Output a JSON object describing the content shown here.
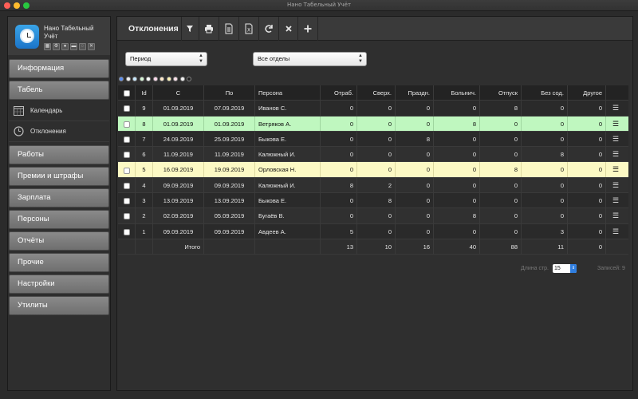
{
  "window": {
    "title": "Нано Табельный Учёт"
  },
  "app": {
    "name": "Нано Табельный Учёт",
    "mini_icons": [
      "calendar-mini-icon",
      "gear-mini-icon",
      "person-mini-icon",
      "card-mini-icon",
      "chat-mini-icon",
      "tools-mini-icon"
    ]
  },
  "sidebar": {
    "buttons": [
      {
        "label": "Информация"
      },
      {
        "label": "Табель"
      },
      {
        "label": "Работы"
      },
      {
        "label": "Премии и штрафы"
      },
      {
        "label": "Зарплата"
      },
      {
        "label": "Персоны"
      },
      {
        "label": "Отчёты"
      },
      {
        "label": "Прочие"
      },
      {
        "label": "Настройки"
      },
      {
        "label": "Утилиты"
      }
    ],
    "sub_items": [
      {
        "label": "Календарь",
        "icon": "calendar-icon"
      },
      {
        "label": "Отклонения",
        "icon": "clock-icon"
      }
    ]
  },
  "toolbar": {
    "title": "Отклонения",
    "buttons": [
      "filter-icon",
      "print-icon",
      "document-icon",
      "excel-icon",
      "refresh-icon",
      "close-icon",
      "add-icon"
    ]
  },
  "filters": {
    "period": "Период",
    "department": "Все отделы"
  },
  "colors": {
    "dots": [
      "#5b8ef2",
      "#f2f2f2",
      "#c7e8ff",
      "#d7f7d7",
      "#ffffff",
      "#ffd9ec",
      "#ffe9c9",
      "#fff4b3",
      "#fce0ea",
      "#f3f3f3",
      "#222222"
    ],
    "highlight_green": "#bff7bf",
    "highlight_yellow": "#fcf9c4"
  },
  "table": {
    "headers": [
      "Id",
      "С",
      "По",
      "Персона",
      "Отраб.",
      "Сверх.",
      "Праздн.",
      "Больнич.",
      "Отпуск",
      "Без сод.",
      "Другое"
    ],
    "rows": [
      {
        "id": "9",
        "from": "01.09.2019",
        "to": "07.09.2019",
        "person": "Иванов С.",
        "v": [
          "0",
          "0",
          "0",
          "0",
          "8",
          "0",
          "0"
        ],
        "hl": ""
      },
      {
        "id": "8",
        "from": "01.09.2019",
        "to": "01.09.2019",
        "person": "Ветряков А.",
        "v": [
          "0",
          "0",
          "0",
          "8",
          "0",
          "0",
          "0"
        ],
        "hl": "green"
      },
      {
        "id": "7",
        "from": "24.09.2019",
        "to": "25.09.2019",
        "person": "Быкова Е.",
        "v": [
          "0",
          "0",
          "8",
          "0",
          "0",
          "0",
          "0"
        ],
        "hl": ""
      },
      {
        "id": "6",
        "from": "11.09.2019",
        "to": "11.09.2019",
        "person": "Калюжный И.",
        "v": [
          "0",
          "0",
          "0",
          "0",
          "0",
          "8",
          "0"
        ],
        "hl": ""
      },
      {
        "id": "5",
        "from": "16.09.2019",
        "to": "19.09.2019",
        "person": "Орловская Н.",
        "v": [
          "0",
          "0",
          "0",
          "0",
          "8",
          "0",
          "0"
        ],
        "hl": "yellow"
      },
      {
        "id": "4",
        "from": "09.09.2019",
        "to": "09.09.2019",
        "person": "Калюжный И.",
        "v": [
          "8",
          "2",
          "0",
          "0",
          "0",
          "0",
          "0"
        ],
        "hl": ""
      },
      {
        "id": "3",
        "from": "13.09.2019",
        "to": "13.09.2019",
        "person": "Быкова Е.",
        "v": [
          "0",
          "8",
          "0",
          "0",
          "0",
          "0",
          "0"
        ],
        "hl": ""
      },
      {
        "id": "2",
        "from": "02.09.2019",
        "to": "05.09.2019",
        "person": "Бугаёв В.",
        "v": [
          "0",
          "0",
          "0",
          "8",
          "0",
          "0",
          "0"
        ],
        "hl": ""
      },
      {
        "id": "1",
        "from": "09.09.2019",
        "to": "09.09.2019",
        "person": "Авдеев А.",
        "v": [
          "5",
          "0",
          "0",
          "0",
          "0",
          "3",
          "0"
        ],
        "hl": ""
      }
    ],
    "total_label": "Итого",
    "totals": [
      "13",
      "10",
      "16",
      "40",
      "88",
      "11",
      "0"
    ]
  },
  "footer": {
    "page_length_label": "Длина стр.",
    "page_length_value": "15",
    "records_label": "Записей: 9"
  }
}
